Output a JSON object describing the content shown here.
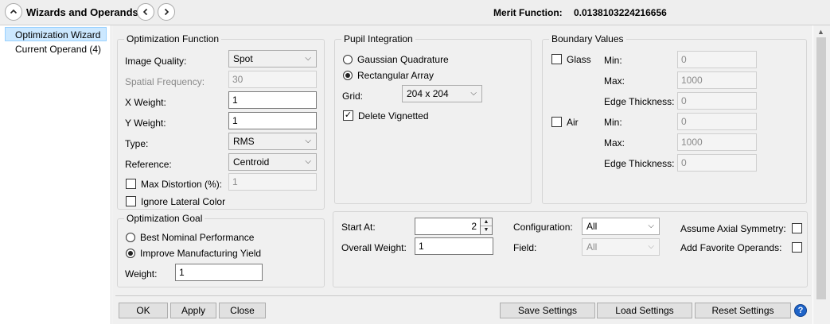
{
  "titlebar": {
    "title": "Wizards and Operands",
    "merit_label": "Merit Function:",
    "merit_value": "0.0138103224216656"
  },
  "left_list": [
    "Optimization Wizard",
    "Current Operand (4)"
  ],
  "optimization_function": {
    "title": "Optimization Function",
    "image_quality_label": "Image Quality:",
    "image_quality_value": "Spot",
    "spatial_freq_label": "Spatial Frequency:",
    "spatial_freq_value": "30",
    "x_weight_label": "X Weight:",
    "x_weight_value": "1",
    "y_weight_label": "Y Weight:",
    "y_weight_value": "1",
    "type_label": "Type:",
    "type_value": "RMS",
    "reference_label": "Reference:",
    "reference_value": "Centroid",
    "max_distortion_label": "Max Distortion (%):",
    "max_distortion_value": "1",
    "ignore_lateral_label": "Ignore Lateral Color"
  },
  "pupil_integration": {
    "title": "Pupil Integration",
    "gaussian_label": "Gaussian Quadrature",
    "rectangular_label": "Rectangular Array",
    "grid_label": "Grid:",
    "grid_value": "204 x 204",
    "delete_vignetted_label": "Delete Vignetted",
    "delete_vignetted_check": "✓"
  },
  "boundary_values": {
    "title": "Boundary Values",
    "glass_label": "Glass",
    "air_label": "Air",
    "min_label": "Min:",
    "max_label": "Max:",
    "edge_label": "Edge Thickness:",
    "glass_min": "0",
    "glass_max": "1000",
    "glass_edge": "0",
    "air_min": "0",
    "air_max": "1000",
    "air_edge": "0"
  },
  "optimization_goal": {
    "title": "Optimization Goal",
    "best_nominal_label": "Best Nominal Performance",
    "improve_yield_label": "Improve Manufacturing Yield",
    "weight_label": "Weight:",
    "weight_value": "1"
  },
  "misc": {
    "start_at_label": "Start At:",
    "start_at_value": "2",
    "overall_weight_label": "Overall Weight:",
    "overall_weight_value": "1",
    "configuration_label": "Configuration:",
    "configuration_value": "All",
    "field_label": "Field:",
    "field_value": "All",
    "assume_axial_label": "Assume Axial Symmetry:",
    "add_favorite_label": "Add Favorite Operands:"
  },
  "buttons": {
    "ok": "OK",
    "apply": "Apply",
    "close": "Close",
    "save_settings": "Save Settings",
    "load_settings": "Load Settings",
    "reset_settings": "Reset Settings",
    "help": "?"
  }
}
